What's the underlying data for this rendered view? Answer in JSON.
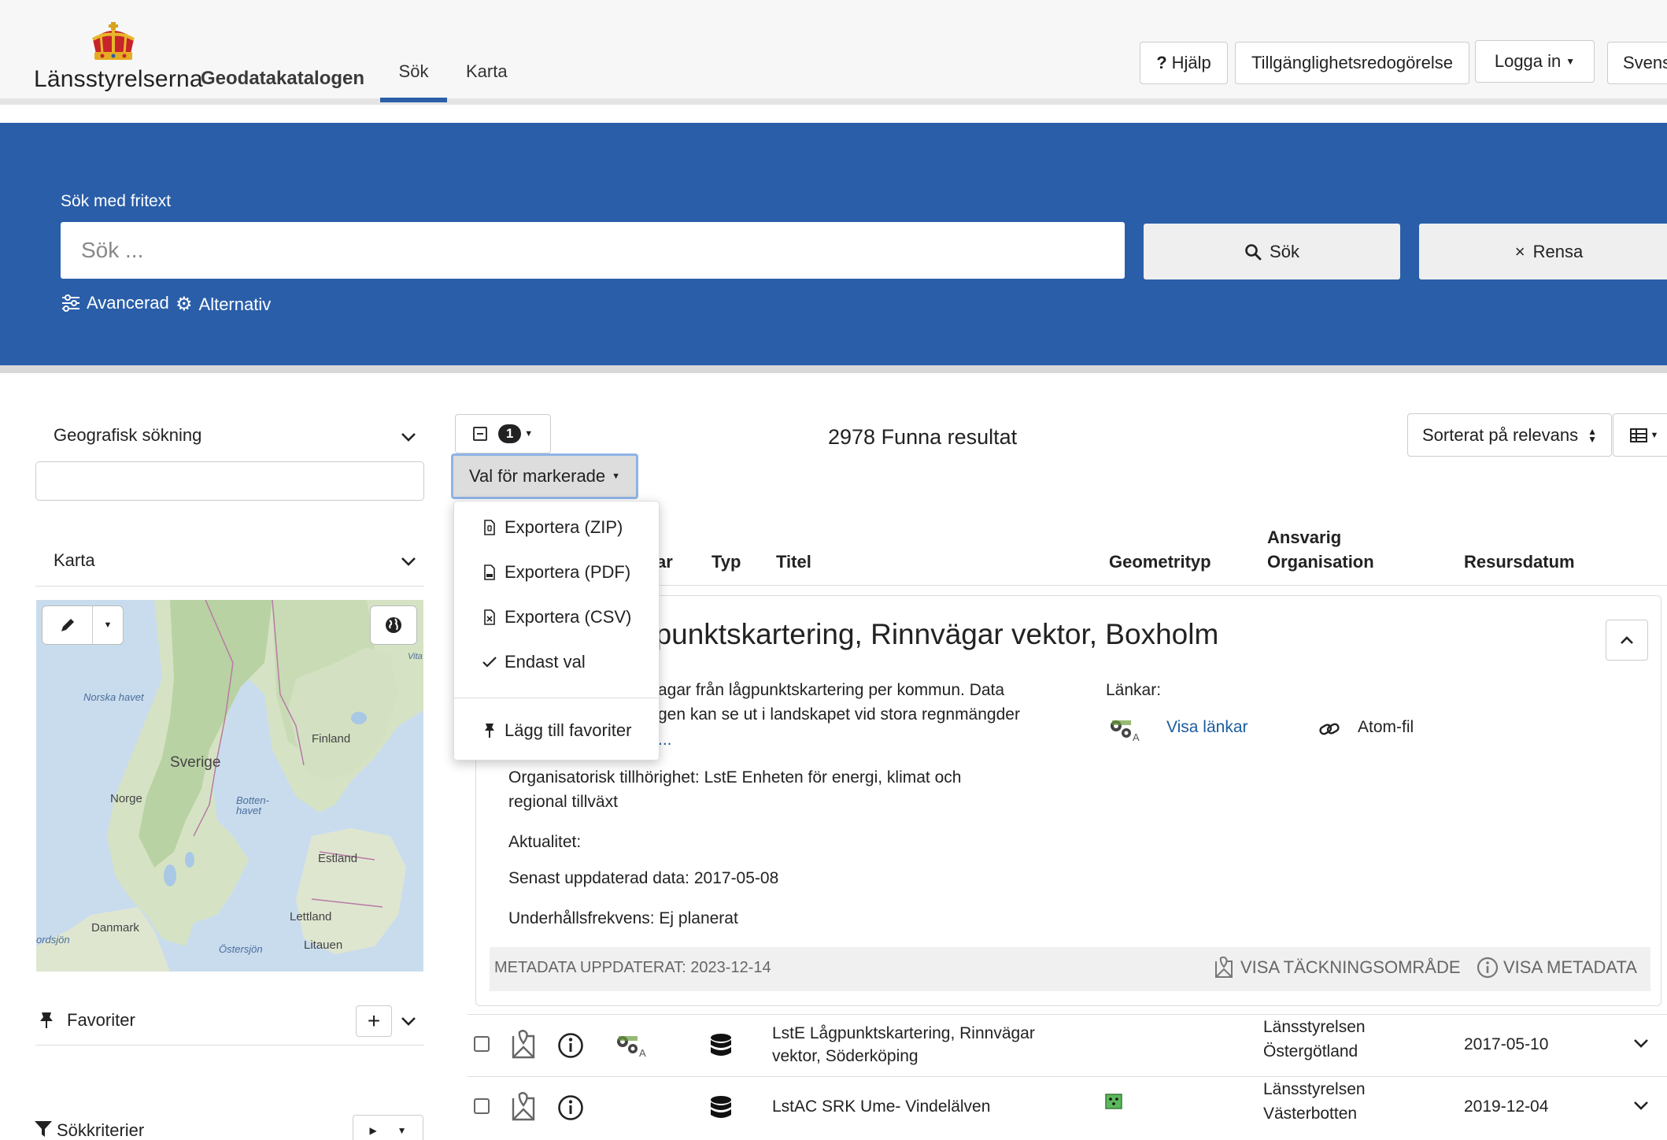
{
  "header": {
    "brand": "Länsstyrelserna",
    "brand_sub": "Geodatakatalogen",
    "tabs": [
      {
        "label": "Sök",
        "active": true
      },
      {
        "label": "Karta",
        "active": false
      }
    ],
    "help_label": "Hjälp",
    "accessibility_label": "Tillgänglighetsredogörelse",
    "login_label": "Logga in",
    "language_label": "Svens"
  },
  "search": {
    "label": "Sök med fritext",
    "placeholder": "Sök ...",
    "search_button": "Sök",
    "clear_button": "Rensa",
    "advanced_label": "Avancerad",
    "options_label": "Alternativ"
  },
  "sidebar": {
    "geo_search_label": "Geografisk sökning",
    "map_label": "Karta",
    "favorites_label": "Favoriter",
    "criteria_label": "Sökkriterier",
    "map_labels": {
      "norska_havet": "Norska havet",
      "finland": "Finland",
      "sverige": "Sverige",
      "norge": "Norge",
      "bottenhavet": "Botten-havet",
      "estland": "Estland",
      "lettland": "Lettland",
      "litauen": "Litauen",
      "danmark": "Danmark",
      "ostersjon": "Östersjön",
      "nordsjon": "ordsjön",
      "vita": "Vita"
    }
  },
  "results": {
    "selected_count": "1",
    "selection_menu_label": "Val för markerade",
    "count_text": "2978 Funna resultat",
    "sort_label": "Sorterat på relevans",
    "columns": {
      "partial": "ar",
      "type": "Typ",
      "title": "Titel",
      "geometry": "Geometrityp",
      "organisation_line1": "Ansvarig",
      "organisation_line2": "Organisation",
      "date": "Resursdatum"
    },
    "dropdown": {
      "export_zip": "Exportera (ZIP)",
      "export_pdf": "Exportera (PDF)",
      "export_csv": "Exportera (CSV)",
      "only_selected": "Endast val",
      "add_favorites": "Lägg till favoriter"
    },
    "expanded": {
      "title": "gpunktskartering, Rinnvägar vektor, Boxholm",
      "desc_line1": "agar från lågpunktskartering per kommun. Data",
      "desc_line2": "gen kan se ut i landskapet vid stora regnmängder",
      "desc_more": "...",
      "org_line1": "Organisatorisk tillhörighet: LstE Enheten för energi, klimat och",
      "org_line2": "regional tillväxt",
      "actuality": "Aktualitet:",
      "last_updated": "Senast uppdaterad data: 2017-05-08",
      "maintenance": "Underhållsfrekvens: Ej planerat",
      "links_label": "Länkar:",
      "show_links": "Visa länkar",
      "atom_label": "Atom-fil",
      "metadata_updated": "METADATA UPPDATERAT: 2023-12-14",
      "show_coverage": "VISA TÄCKNINGSOMRÅDE",
      "show_metadata": "VISA METADATA"
    },
    "rows": [
      {
        "title_line1": "LstE Lågpunktskartering, Rinnvägar",
        "title_line2": "vektor, Söderköping",
        "org_line1": "Länsstyrelsen",
        "org_line2": "Östergötland",
        "date": "2017-05-10"
      },
      {
        "title_line1": "LstAC SRK Ume- Vindelälven",
        "org_line1": "Länsstyrelsen",
        "org_line2": "Västerbotten",
        "date": "2019-12-04"
      }
    ]
  },
  "colors": {
    "brand_blue": "#2a5ea9",
    "link_blue": "#1a5c9e",
    "geometry_green": "#5cb85c"
  }
}
